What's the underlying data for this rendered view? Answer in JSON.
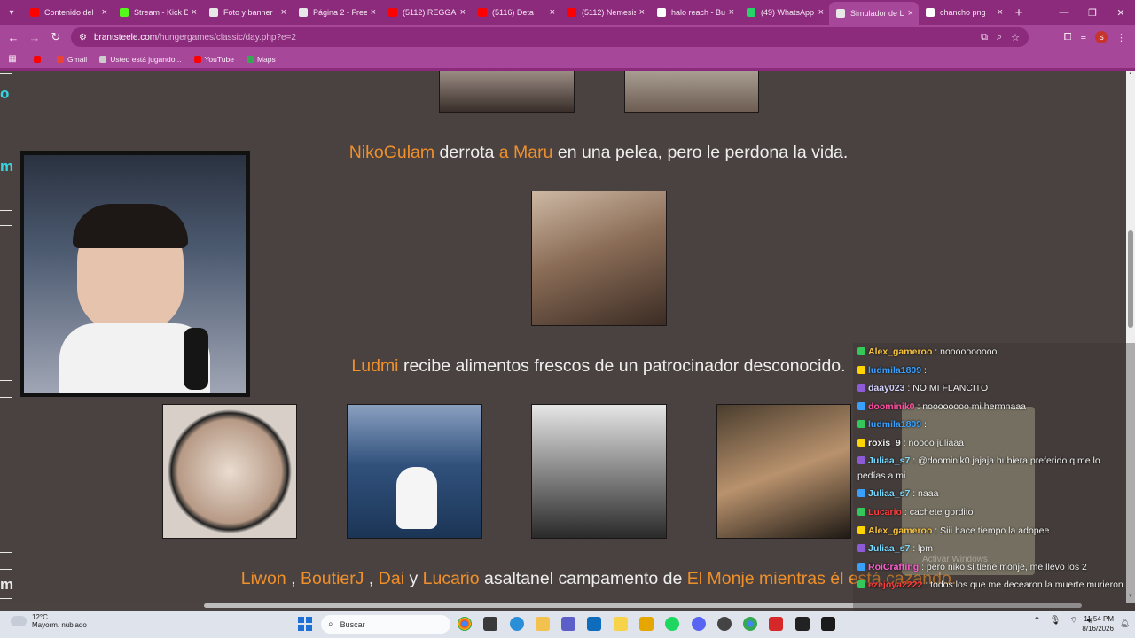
{
  "browser": {
    "tabs": [
      {
        "label": "Contenido del",
        "icon": "youtube-icon",
        "color": "#ff0000"
      },
      {
        "label": "Stream - Kick D",
        "icon": "kick-icon",
        "color": "#53fc18"
      },
      {
        "label": "Foto y banner",
        "icon": "generic-tab-icon",
        "color": "#e8e8e8"
      },
      {
        "label": "Página 2 - Free",
        "icon": "generic-tab-icon",
        "color": "#e8e8e8"
      },
      {
        "label": "(5112) REGGAE",
        "icon": "youtube-icon",
        "color": "#ff0000"
      },
      {
        "label": "(5116) Deta",
        "icon": "youtube-icon",
        "color": "#ff0000"
      },
      {
        "label": "(5112) Nemesis",
        "icon": "youtube-icon",
        "color": "#ff0000"
      },
      {
        "label": "halo reach - Bu",
        "icon": "google-icon",
        "color": "#ffffff"
      },
      {
        "label": "(49) WhatsApp",
        "icon": "whatsapp-icon",
        "color": "#25d366"
      },
      {
        "label": "Simulador de L",
        "icon": "generic-tab-icon",
        "color": "#e8e8e8",
        "active": true
      },
      {
        "label": "chancho png",
        "icon": "google-icon",
        "color": "#ffffff"
      }
    ],
    "url_host": "brantsteele.com",
    "url_path": "/hungergames/classic/day.php?e=2",
    "bookmarks": [
      {
        "label": "",
        "icon": "youtube-icon",
        "color": "#ff0000"
      },
      {
        "label": "Gmail",
        "icon": "gmail-icon",
        "color": "#ea4335"
      },
      {
        "label": "Usted está jugando...",
        "icon": "globe-icon",
        "color": "#cccccc"
      },
      {
        "label": "YouTube",
        "icon": "youtube-icon",
        "color": "#ff0000"
      },
      {
        "label": "Maps",
        "icon": "maps-icon",
        "color": "#34a853"
      }
    ]
  },
  "page": {
    "event1": {
      "p1": "NikoGulam",
      "mid": " derrota ",
      "p2": "a Maru",
      "end": " en una pelea, pero le perdona la vida."
    },
    "event2": {
      "p1": "Ludmi",
      "end": " recibe alimentos frescos de un patrocinador desconocido."
    },
    "event3": {
      "p1": "Liwon",
      "s1": " , ",
      "p2": "BoutierJ",
      "s2": " , ",
      "p3": "Dai",
      "s3": " y ",
      "p4": "Lucario",
      "mid": " asaltanel campamento de ",
      "p5": "El Monje",
      "end": " mientras él está cazando."
    },
    "tribute_color": "#f0902a"
  },
  "stream_edge": [
    "o",
    "m",
    "m"
  ],
  "chat": [
    {
      "user": "Alex_gameroo",
      "color": "#f5c242",
      "msg": ": noooooooooo"
    },
    {
      "user": "ludmila1809",
      "color": "#3aa0ff",
      "msg": ":"
    },
    {
      "user": "daay023",
      "color": "#d3d3ff",
      "msg": ": NO MI FLANCITO"
    },
    {
      "user": "doominik0",
      "color": "#ff4fa0",
      "msg": ": noooooooo mi hermnaaa"
    },
    {
      "user": "ludmila1809",
      "color": "#3aa0ff",
      "msg": ":"
    },
    {
      "user": "roxis_9",
      "color": "#f2f2f2",
      "msg": ": noooo juliaaa"
    },
    {
      "user": "Juliaa_s7",
      "color": "#7ad9ff",
      "msg": ": @doominik0 jajaja hubiera preferido q me lo pedías a mi"
    },
    {
      "user": "Juliaa_s7",
      "color": "#7ad9ff",
      "msg": ": naaa"
    },
    {
      "user": "Lucario",
      "color": "#ff3b3b",
      "msg": ": cachete gordito"
    },
    {
      "user": "Alex_gameroo",
      "color": "#f5c242",
      "msg": ": Siii hace tiempo la adopee"
    },
    {
      "user": "Juliaa_s7",
      "color": "#7ad9ff",
      "msg": ": lpm"
    },
    {
      "user": "RoiCrafting",
      "color": "#ff5fd2",
      "msg": ": pero niko si tiene monje, me llevo los 2"
    },
    {
      "user": "ezejoya2222",
      "color": "#ff3b3b",
      "msg": ": todos los que me decearon la muerte murieron"
    }
  ],
  "watermark": "Activar Windows",
  "taskbar": {
    "temp": "12°C",
    "weather": "Mayorm. nublado",
    "search_placeholder": "Buscar",
    "time": "11:54 PM",
    "date": "8/16/2026"
  }
}
